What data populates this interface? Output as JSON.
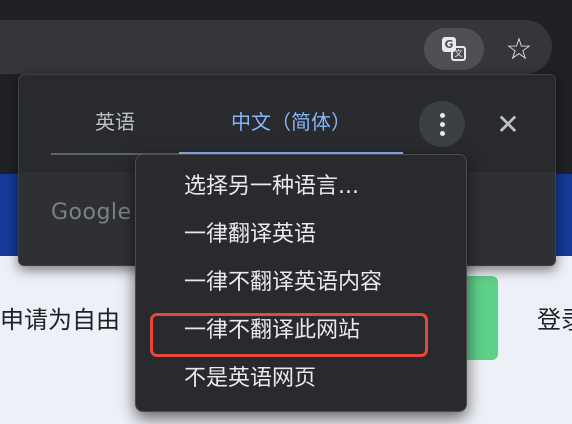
{
  "toolbar": {
    "translate_icon": "translate-icon",
    "star_icon": "star-icon",
    "star_glyph": "☆"
  },
  "page": {
    "text_left": "申请为自由",
    "text_right": "登录"
  },
  "translate_bubble": {
    "tabs": [
      {
        "label": "英语",
        "selected": false
      },
      {
        "label": "中文（简体）",
        "selected": true
      }
    ],
    "more_icon": "more-vert-icon",
    "close_icon": "close-icon",
    "close_glyph": "✕",
    "footer_logo": "Google"
  },
  "options_menu": {
    "items": [
      {
        "label": "选择另一种语言..."
      },
      {
        "label": "一律翻译英语"
      },
      {
        "label": "一律不翻译英语内容"
      },
      {
        "label": "一律不翻译此网站",
        "highlighted": true
      },
      {
        "label": "不是英语网页"
      }
    ]
  },
  "colors": {
    "accent": "#8ab4f8",
    "highlight": "#e8473d",
    "banner": "#17399a"
  }
}
